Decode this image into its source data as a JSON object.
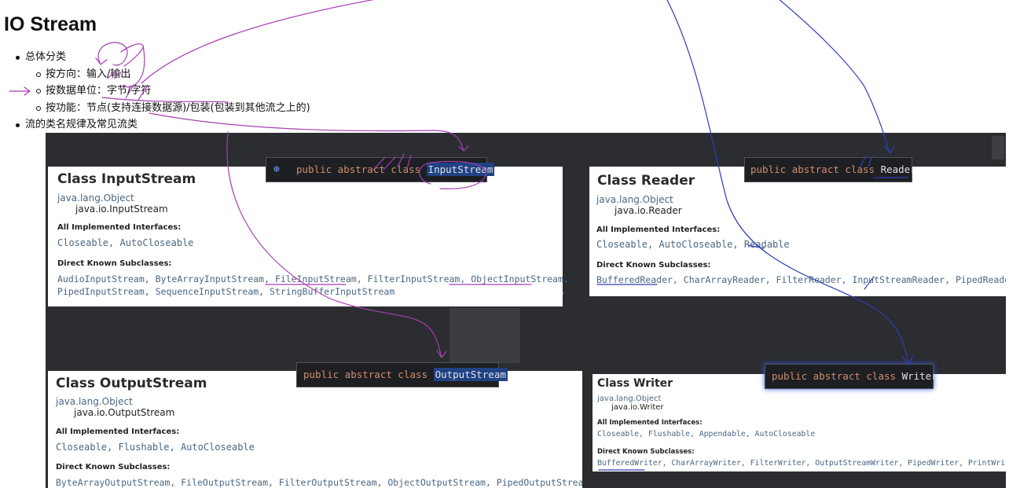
{
  "page": {
    "title": "IO Stream"
  },
  "bullets": {
    "overview": "总体分类",
    "direction": "按方向：输入/输出",
    "unit": "按数据单位：字节/字符",
    "function": "按功能：节点(支持连接数据源)/包装(包装到其他流之上的)",
    "naming": "流的类名规律及常见流类"
  },
  "cards": {
    "inputstream": {
      "title": "Class InputStream",
      "pkg_parent": "java.lang.Object",
      "pkg_class": "java.io.InputStream",
      "interfaces_label": "All Implemented Interfaces:",
      "interfaces": "Closeable, AutoCloseable",
      "subclasses_label": "Direct Known Subclasses:",
      "subclasses_line1": "AudioInputStream, ByteArrayInputStream, FileInputStream, FilterInputStream, ObjectInputStream,",
      "subclasses_line2": "PipedInputStream, SequenceInputStream, StringBufferInputStream"
    },
    "reader": {
      "title": "Class Reader",
      "pkg_parent": "java.lang.Object",
      "pkg_class": "java.io.Reader",
      "interfaces_label": "All Implemented Interfaces:",
      "interfaces": "Closeable, AutoCloseable, Readable",
      "subclasses_label": "Direct Known Subclasses:",
      "subclasses_line1": "BufferedReader, CharArrayReader, FilterReader, InputStreamReader, PipedReader, S"
    },
    "outputstream": {
      "title": "Class OutputStream",
      "pkg_parent": "java.lang.Object",
      "pkg_class": "java.io.OutputStream",
      "interfaces_label": "All Implemented Interfaces:",
      "interfaces": "Closeable, Flushable, AutoCloseable",
      "subclasses_label": "Direct Known Subclasses:",
      "subclasses_line1": "ByteArrayOutputStream, FileOutputStream, FilterOutputStream, ObjectOutputStream, PipedOutputStream"
    },
    "writer": {
      "title": "Class Writer",
      "pkg_parent": "java.lang.Object",
      "pkg_class": "java.io.Writer",
      "interfaces_label": "All Implemented Interfaces:",
      "interfaces": "Closeable, Flushable, Appendable, AutoCloseable",
      "subclasses_label": "Direct Known Subclasses:",
      "subclasses_line1": "BufferedWriter, CharArrayWriter, FilterWriter, OutputStreamWriter, PipedWriter, PrintWriter, String\\"
    }
  },
  "tooltips": {
    "keywords": "public abstract class",
    "inputstream": "InputStream",
    "reader": "Reader",
    "outputstream": "OutputStream",
    "writer": "Writer"
  },
  "colors": {
    "pen_purple": "#a63fb3",
    "pen_blue": "#2f3fb5",
    "keyword": "#cf8e6d",
    "highlight": "#214283"
  },
  "icons": {
    "inspect": "magnifier-gear-icon",
    "expand": "diamond-icon"
  }
}
